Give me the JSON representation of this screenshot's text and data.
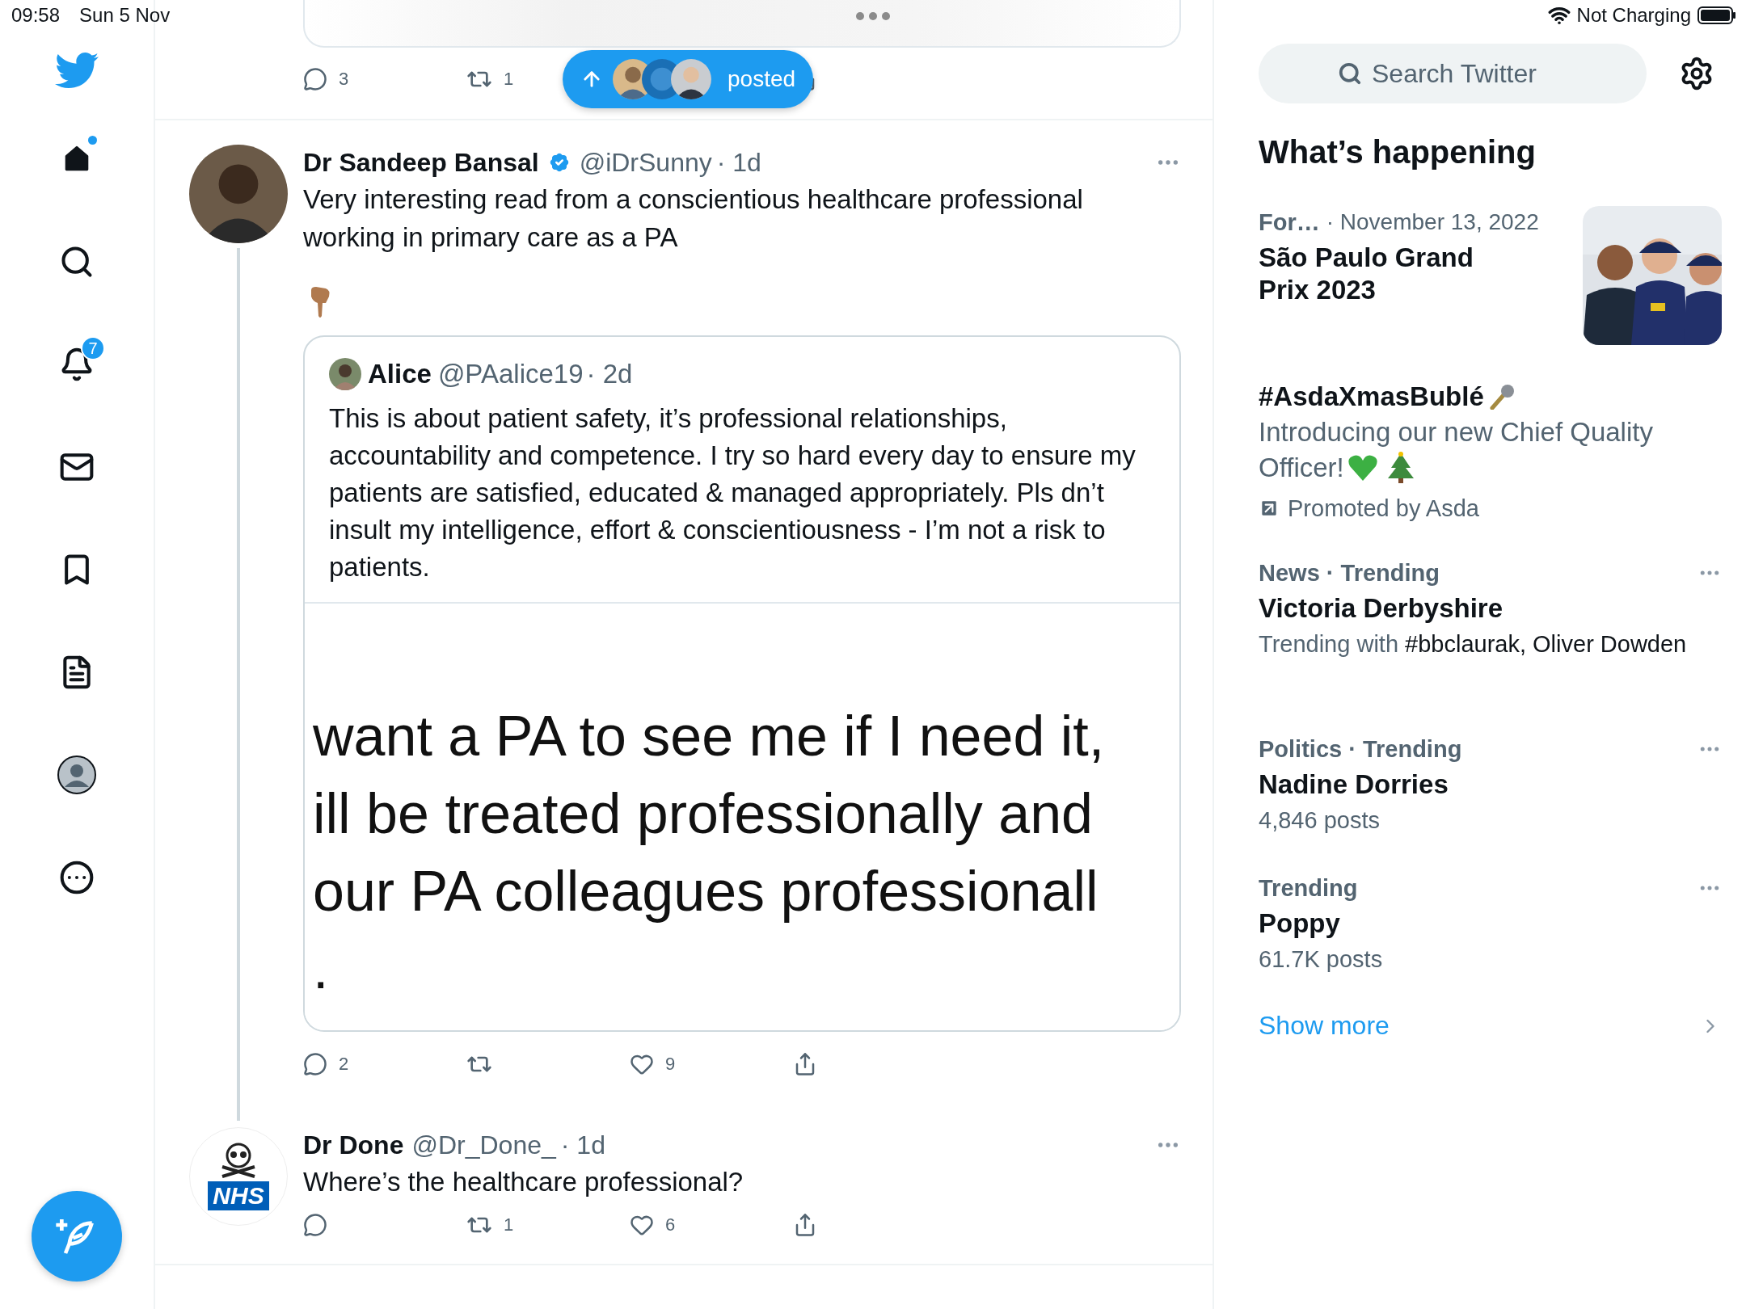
{
  "status_bar": {
    "time": "09:58",
    "date": "Sun 5 Nov",
    "battery_status": "Not Charging"
  },
  "nav_items": [
    {
      "kind": "home",
      "selected": true,
      "dot": true
    },
    {
      "kind": "explore",
      "selected": false,
      "dot": false
    },
    {
      "kind": "notifications",
      "selected": false,
      "dot": false,
      "badge": "7"
    },
    {
      "kind": "messages",
      "selected": false,
      "dot": false
    },
    {
      "kind": "bookmarks",
      "selected": false,
      "dot": false
    },
    {
      "kind": "lists",
      "selected": false,
      "dot": false
    },
    {
      "kind": "profile",
      "selected": false,
      "dot": false
    },
    {
      "kind": "more",
      "selected": false,
      "dot": false
    }
  ],
  "previous_tweet": {
    "replies": "3",
    "retweets": "1"
  },
  "new_posts_pill": {
    "label": "posted"
  },
  "tweets": [
    {
      "name": "Dr Sandeep Bansal",
      "verified": true,
      "handle": "@iDrSunny",
      "time": "· 1d",
      "text": "Very interesting read from a conscientious healthcare professional working in primary care as a PA",
      "pointing_emoji": true,
      "thread": true,
      "quote": {
        "name": "Alice",
        "handle": "@PAalice19",
        "time": "· 2d",
        "text": "This is about patient safety, it’s professional relationships, accountability and competence. I try so hard every day to ensure my patients are satisfied, educated & managed appropriately. Pls dn’t insult my intelligence, effort & conscientiousness - I’m not a risk to patients.",
        "image_lines": [
          "want a PA to see me if I need it,",
          "ill be treated professionally and",
          "our PA colleagues professionall",
          "."
        ]
      },
      "replies": "2",
      "likes": "9"
    },
    {
      "name": "Dr Done",
      "verified": false,
      "handle": "@Dr_Done_",
      "time": "· 1d",
      "avatar_label": "NHS",
      "text": "Where’s the healthcare professional?",
      "pointing_emoji": false,
      "thread": false,
      "retweets": "1",
      "likes": "6"
    }
  ],
  "sidebar": {
    "search": {
      "placeholder": "Search Twitter"
    },
    "heading": "What’s happening",
    "trends": [
      {
        "kind": "event",
        "context": "For…",
        "meta": "· November 13, 2022",
        "title": "São Paulo Grand Prix 2023"
      },
      {
        "kind": "promoted",
        "title": "#AsdaXmasBublé",
        "description_lines": [
          "Introducing our new Chief Quality",
          "Officer!"
        ],
        "promoted_by": "Promoted by Asda"
      },
      {
        "kind": "trend",
        "context": "News · Trending",
        "title": "Victoria Derbyshire",
        "detail": "Trending with",
        "detail_terms": "#bbclaurak, Oliver Dowden"
      },
      {
        "kind": "trend",
        "context": "Politics · Trending",
        "title": "Nadine Dorries",
        "detail": "4,846 posts"
      },
      {
        "kind": "trend",
        "context": "Trending",
        "title": "Poppy",
        "detail": "61.7K posts"
      }
    ],
    "show_more": "Show more"
  }
}
